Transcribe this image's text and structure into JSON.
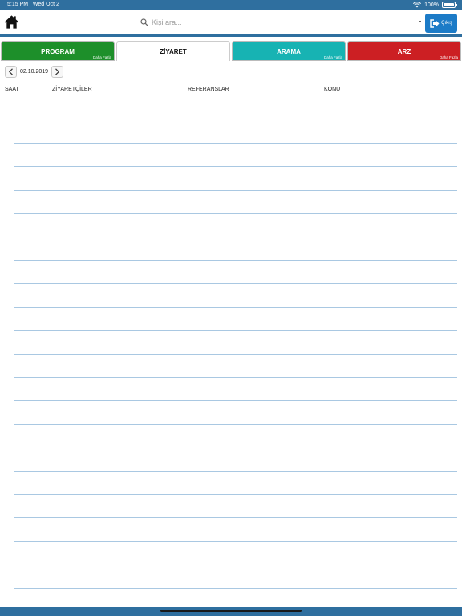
{
  "status_bar": {
    "time": "5:15 PM",
    "date": "Wed Oct 2",
    "battery_text": "100%",
    "battery_level": 1.0
  },
  "header": {
    "search_placeholder": "Kişi ara...",
    "exit_label": "Çıkış"
  },
  "tabs": [
    {
      "label": "PROGRAM",
      "more": "Daha Fazla",
      "color": "#1d8f2a",
      "active": false
    },
    {
      "label": "ZİYARET",
      "more": "",
      "color": "#ffffff",
      "active": true
    },
    {
      "label": "ARAMA",
      "more": "Daha Fazla",
      "color": "#17b3b3",
      "active": false
    },
    {
      "label": "ARZ",
      "more": "Daha Fazla",
      "color": "#cc1f23",
      "active": false
    }
  ],
  "date_nav": {
    "date": "02.10.2019"
  },
  "table": {
    "columns": [
      "SAAT",
      "ZİYARETÇİLER",
      "REFERANSLAR",
      "KONU"
    ]
  },
  "colors": {
    "brand_blue": "#2f6f9f",
    "exit_button": "#1c7bc7",
    "row_line": "#a9c8e2"
  }
}
